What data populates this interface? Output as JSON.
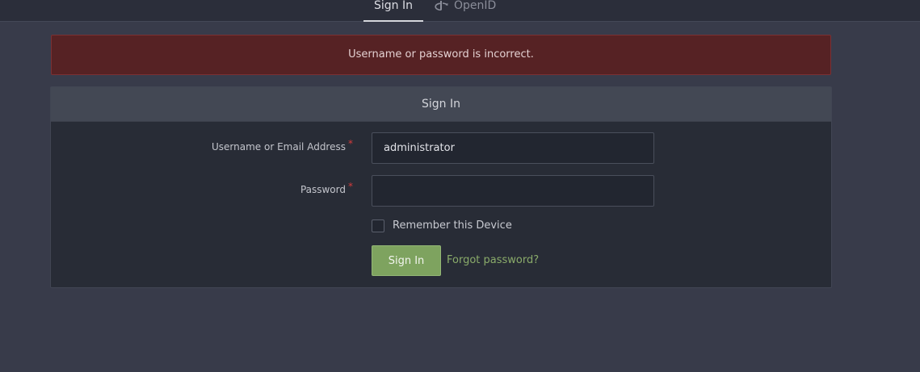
{
  "tabs": {
    "signin_label": "Sign In",
    "openid_label": "OpenID"
  },
  "alert": {
    "message": "Username or password is incorrect."
  },
  "panel": {
    "title": "Sign In"
  },
  "form": {
    "username_label": "Username or Email Address",
    "username_value": "administrator",
    "password_label": "Password",
    "password_value": "",
    "required_mark": "*",
    "remember_label": "Remember this Device",
    "remember_checked": false,
    "submit_label": "Sign In",
    "forgot_label": "Forgot password?"
  },
  "colors": {
    "background": "#383b4a",
    "alert_bg": "#562224",
    "primary_button": "#7ea35f",
    "link": "#8aab6a",
    "required": "#d33b3b"
  },
  "icons": {
    "openid": "openid-icon"
  }
}
